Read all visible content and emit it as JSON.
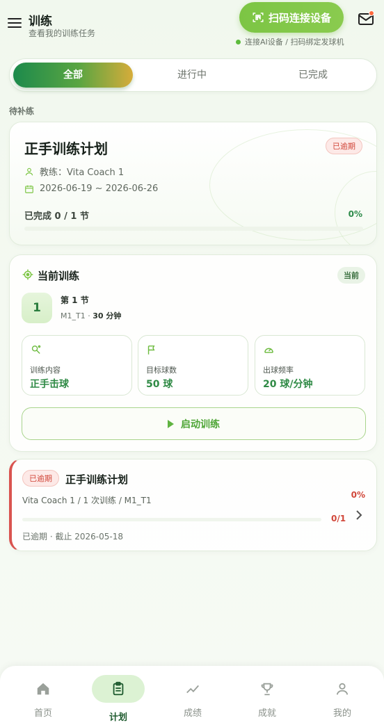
{
  "header": {
    "title": "训练",
    "subtitle": "查看我的训练任务",
    "scan_button": "扫码连接设备",
    "device_status": "连接AI设备 / 扫码绑定发球机"
  },
  "tabs": [
    {
      "label": "全部",
      "active": true
    },
    {
      "label": "进行中",
      "active": false
    },
    {
      "label": "已完成",
      "active": false
    }
  ],
  "section_label": "待补练",
  "plan_card": {
    "title": "正手训练计划",
    "badge": "已逾期",
    "coach": "教练：Vita Coach 1",
    "date_range": "2026-06-19 ~ 2026-06-26",
    "progress_text": "已完成 0 / 1 节",
    "progress_pct": "0%",
    "progress_value": 0
  },
  "current_training": {
    "title": "当前训练",
    "badge": "当前",
    "session_number": "1",
    "session_label": "第 1 节",
    "session_code": "M1_T1 · ",
    "session_duration": "30 分钟",
    "stats": [
      {
        "label": "训练内容",
        "value": "正手击球",
        "icon": "racket-icon"
      },
      {
        "label": "目标球数",
        "value": "50 球",
        "icon": "flag-icon"
      },
      {
        "label": "出球频率",
        "value": "20 球/分钟",
        "icon": "gauge-icon"
      }
    ],
    "start_button": "启动训练"
  },
  "plan_list_item": {
    "badge": "已逾期",
    "title": "正手训练计划",
    "meta": "Vita Coach 1 / 1 次训练 / M1_T1",
    "pct": "0%",
    "count": "0/1",
    "footer": "已逾期 · 截止 2026-05-18",
    "progress_value": 0
  },
  "bottom_nav": [
    {
      "label": "首页",
      "icon": "home-icon",
      "active": false
    },
    {
      "label": "计划",
      "icon": "clipboard-icon",
      "active": true
    },
    {
      "label": "成绩",
      "icon": "trend-icon",
      "active": false
    },
    {
      "label": "成就",
      "icon": "trophy-icon",
      "active": false
    },
    {
      "label": "我的",
      "icon": "user-icon",
      "active": false
    }
  ],
  "colors": {
    "accent_green": "#2f8a45",
    "light_green": "#7cc544",
    "overdue_red": "#d1473a"
  }
}
